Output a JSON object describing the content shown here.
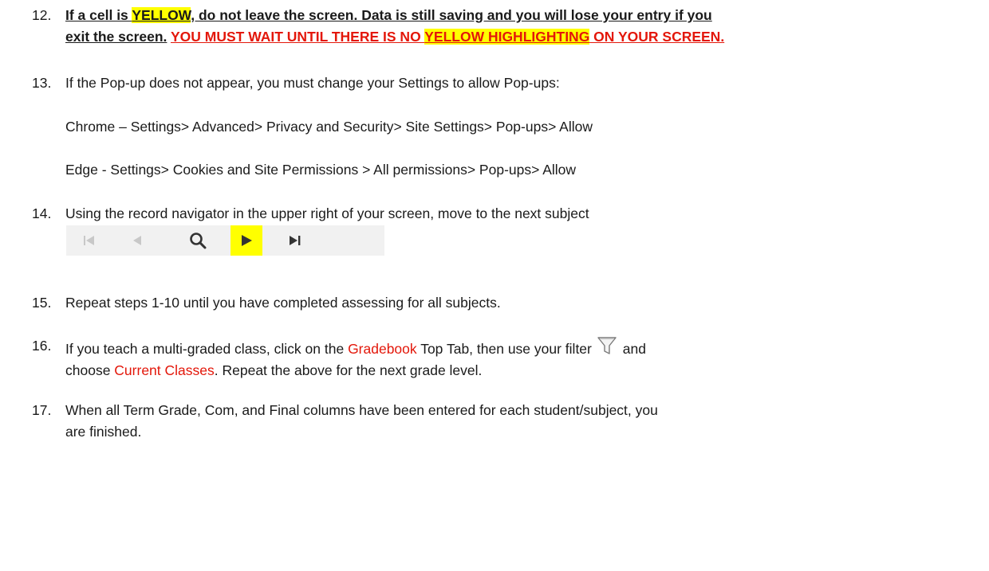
{
  "step12": {
    "num": "12.",
    "lead_a": "If a cell is ",
    "lead_hl": "YELLOW",
    "lead_b": ", do not leave the screen. Data is still saving and you will lose your entry if you",
    "lead_c": "exit the screen.",
    "warn_a": "YOU MUST WAIT UNTIL THERE IS NO ",
    "warn_hl": "YELLOW HIGHLIGHTING",
    "warn_b": " ON YOUR SCREEN."
  },
  "step13": {
    "num": "13.",
    "text": "If the Pop-up does not appear, you must change your Settings to allow Pop-ups:",
    "chrome": "Chrome – Settings> Advanced> Privacy and Security> Site Settings> Pop-ups> Allow",
    "edge": "Edge - Settings> Cookies and Site Permissions > All permissions> Pop-ups> Allow"
  },
  "step14": {
    "num": "14.",
    "text": "Using the record navigator in the upper right of your screen, move to the next subject"
  },
  "navigator": {
    "buttons": [
      "first-record-icon",
      "previous-record-icon",
      "search-icon",
      "next-record-icon",
      "last-record-icon"
    ],
    "highlighted": "next-record-icon",
    "colors": {
      "disabled": "#c8c8c8",
      "enabled": "#333333",
      "highlight": "#ffff00",
      "bar": "#f1f1f1"
    }
  },
  "step15": {
    "num": "15.",
    "text": "Repeat steps 1-10 until you have completed assessing for all subjects."
  },
  "step16": {
    "num": "16.",
    "a": "If you teach a multi-graded class, click on the ",
    "gradebook": "Gradebook",
    "b": " Top Tab, then use your filter",
    "c": " and",
    "d": "choose ",
    "current": "Current Classes",
    "e": ".  Repeat the above for the next grade level."
  },
  "step17": {
    "num": "17.",
    "line1": "When all Term Grade, Com, and Final columns have been entered for each student/subject, you",
    "line2": "are finished."
  },
  "colors": {
    "accent_red": "#e3170a",
    "highlight_yellow": "#ffff00"
  }
}
